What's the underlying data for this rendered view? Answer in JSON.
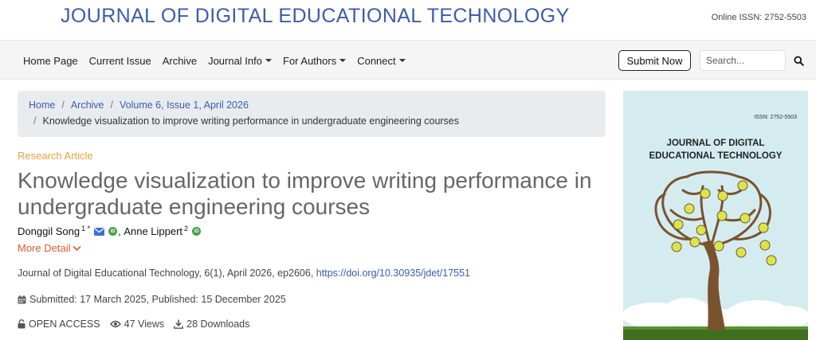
{
  "header": {
    "journal_title": "JOURNAL OF DIGITAL EDUCATIONAL TECHNOLOGY",
    "issn": "Online ISSN: 2752-5503"
  },
  "nav": {
    "items": [
      {
        "label": "Home Page",
        "dropdown": false
      },
      {
        "label": "Current Issue",
        "dropdown": false
      },
      {
        "label": "Archive",
        "dropdown": false
      },
      {
        "label": "Journal Info",
        "dropdown": true
      },
      {
        "label": "For Authors",
        "dropdown": true
      },
      {
        "label": "Connect",
        "dropdown": true
      }
    ],
    "submit_label": "Submit Now",
    "search_placeholder": "Search...",
    "search_icon": "search-icon"
  },
  "breadcrumb": {
    "home": "Home",
    "archive": "Archive",
    "issue": "Volume 6, Issue 1, April 2026",
    "current": "Knowledge visualization to improve writing performance in undergraduate engineering courses"
  },
  "article": {
    "type": "Research Article",
    "title": "Knowledge visualization to improve writing performance in undergraduate engineering courses",
    "authors": [
      {
        "name": "Donggil Song",
        "sup": "1 *",
        "email_icon": true,
        "orcid": true
      },
      {
        "name": "Anne Lippert",
        "sup": "2",
        "email_icon": false,
        "orcid": true
      }
    ],
    "more_detail": "More Detail",
    "citation_prefix": "Journal of Digital Educational Technology, 6(1), April 2026, ep2606,",
    "doi": "https://doi.org/10.30935/jdet/17551",
    "dates": "Submitted: 17 March 2025, Published: 15 December 2025",
    "open_access": "OPEN ACCESS",
    "views": "47 Views",
    "downloads": "28 Downloads"
  },
  "cover": {
    "issn": "ISSN: 2752-5503",
    "title_line1": "JOURNAL OF DIGITAL",
    "title_line2": "EDUCATIONAL TECHNOLOGY"
  },
  "colors": {
    "brand_blue": "#3b5cad",
    "article_type": "#e8a23a",
    "more_detail": "#e05a2b",
    "orcid_green": "#43a047",
    "cover_bg": "#d4ecef"
  }
}
